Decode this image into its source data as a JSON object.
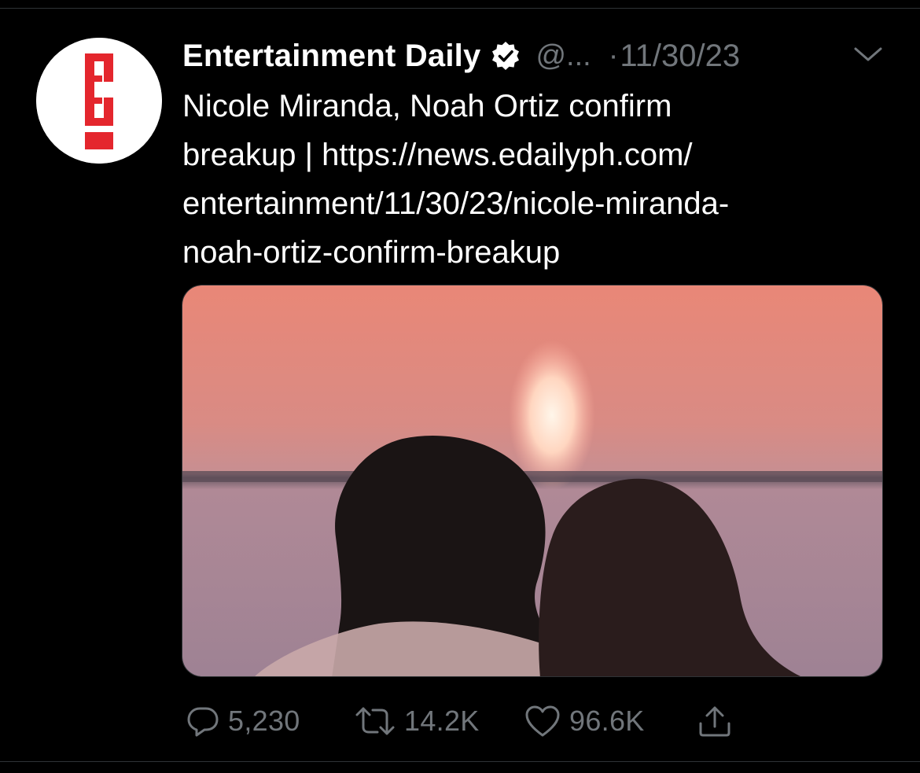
{
  "tweet": {
    "author": {
      "display_name": "Entertainment Daily",
      "verified": true,
      "handle": "@...",
      "avatar_icon": "e-exclamation-logo"
    },
    "separator": "·",
    "timestamp": "11/30/23",
    "text_lines": [
      "Nicole Miranda, Noah Ortiz confirm",
      "breakup | https://news.edailyph.com/",
      "entertainment/11/30/23/nicole-miranda-",
      "noah-ortiz-confirm-breakup"
    ],
    "media": {
      "alt": "couple silhouetted at sunset"
    },
    "actions": {
      "reply_count": "5,230",
      "retweet_count": "14.2K",
      "like_count": "96.6K"
    }
  },
  "colors": {
    "background": "#000000",
    "text_primary": "#ffffff",
    "text_secondary": "#71767b",
    "logo_red": "#e4262d",
    "divider": "#2f3336"
  }
}
